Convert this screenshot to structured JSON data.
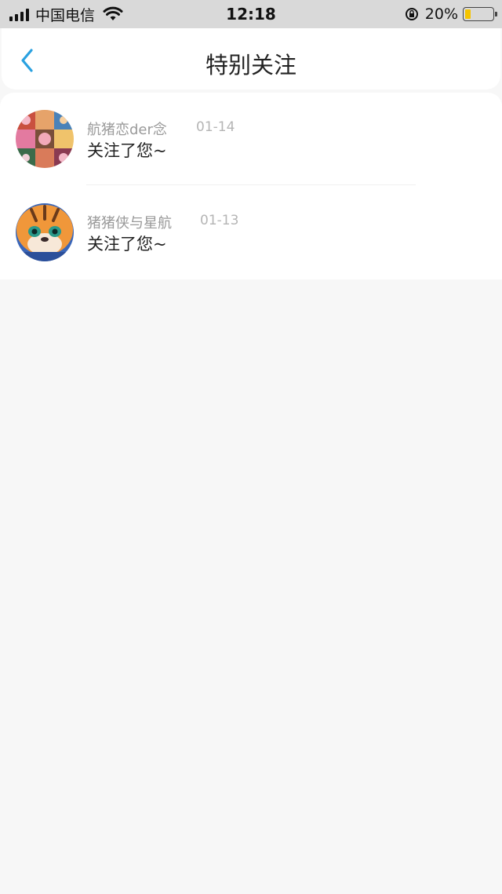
{
  "status_bar": {
    "carrier": "中国电信",
    "time": "12:18",
    "battery_percent": "20%",
    "battery_level": 0.2,
    "battery_color": "#f5c400"
  },
  "nav": {
    "back_icon": "chevron-left-icon",
    "title": "特别关注",
    "accent": "#2aa1e0"
  },
  "items": [
    {
      "name": "航猪恋der念",
      "date": "01-14",
      "message": "关注了您~",
      "avatar": "avatar-image"
    },
    {
      "name": "猪猪侠与星航",
      "date": "01-13",
      "message": "关注了您~",
      "avatar": "avatar-image"
    }
  ]
}
